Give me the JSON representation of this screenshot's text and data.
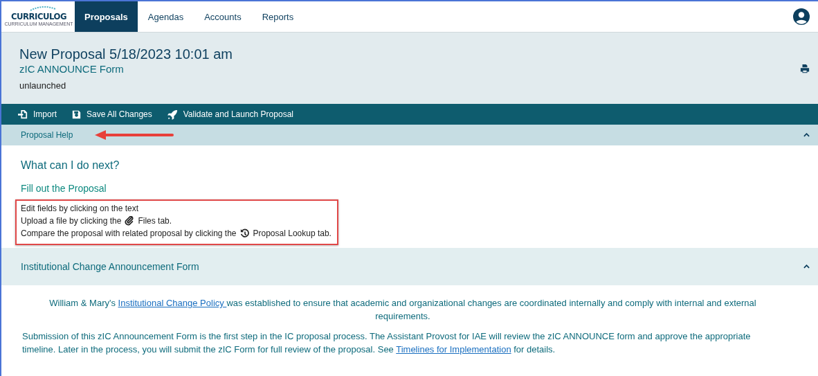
{
  "nav": {
    "logo": "CURRICULOG",
    "logo_sub": "CURRICULUM MANAGEMENT",
    "tabs": [
      {
        "label": "Proposals",
        "selected": true
      },
      {
        "label": "Agendas",
        "selected": false
      },
      {
        "label": "Accounts",
        "selected": false
      },
      {
        "label": "Reports",
        "selected": false
      }
    ]
  },
  "header": {
    "title": "New Proposal 5/18/2023 10:01 am",
    "form": "zIC ANNOUNCE Form",
    "status": "unlaunched"
  },
  "toolbar": [
    {
      "label": "Import",
      "kind": "import"
    },
    {
      "label": "Save All Changes",
      "kind": "save"
    },
    {
      "label": "Validate and Launch Proposal",
      "kind": "launch"
    }
  ],
  "help": {
    "title": "Proposal Help",
    "expanded": true,
    "heading": "What can I do next?",
    "subheading": "Fill out the Proposal",
    "lines": [
      {
        "before": "Edit fields by clicking on the text"
      },
      {
        "before": "Upload a file by clicking the",
        "kind": "files",
        "after": "Files tab."
      },
      {
        "before": "Compare the proposal with related proposal by clicking the",
        "kind": "lookup",
        "after": "Proposal Lookup tab."
      }
    ]
  },
  "section": {
    "title": "Institutional Change Announcement Form",
    "expanded": true,
    "paragraphs": [
      {
        "kind": "intro",
        "before": "William & Mary's ",
        "link": "Institutional Change Policy ",
        "after": "was established to ensure that academic and organizational changes are coordinated internally and comply with internal and external requirements."
      },
      {
        "kind": "body",
        "before": "Submission of this zIC Announcement Form is the first step in the IC proposal process. The Assistant Provost for IAE will review the zIC ANNOUNCE form and approve the appropriate timeline. Later in the process, you will submit the zIC Form for full review of the proposal. See ",
        "link": "Timelines for Implementation",
        "after": " for details."
      }
    ]
  }
}
